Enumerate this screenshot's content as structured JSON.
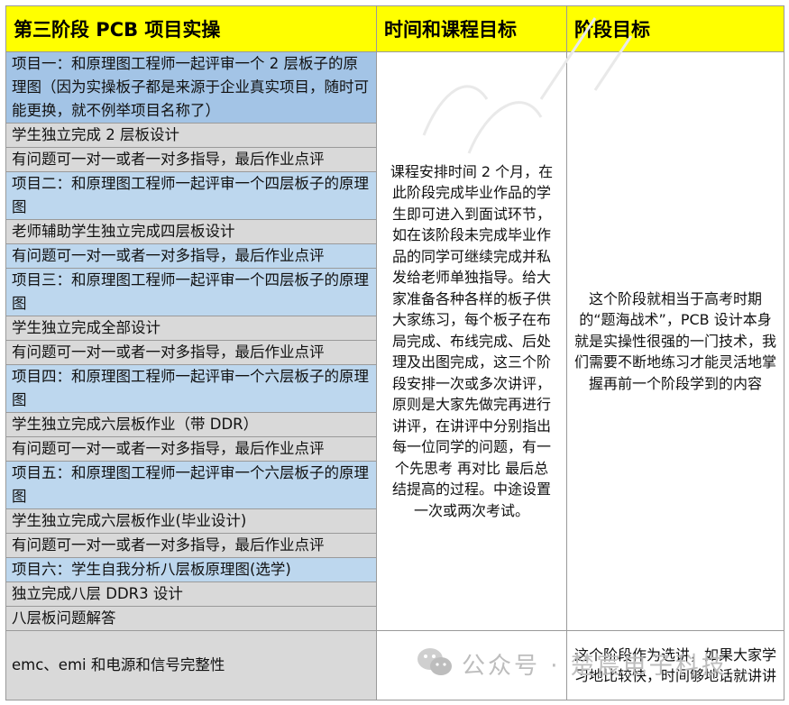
{
  "headers": {
    "col1": "第三阶段 PCB  项目实操",
    "col2": "时间和课程目标",
    "col3": "阶段目标"
  },
  "rows": [
    {
      "text": "项目一：和原理图工程师一起评审一个 2 层板子的原理图（因为实操板子都是来源于企业真实项目，随时可能更换，就不例举项目名称了）",
      "style": "first-blue"
    },
    {
      "text": "学生独立完成 2 层板设计",
      "style": "gray"
    },
    {
      "text": "有问题可一对一或者一对多指导，最后作业点评",
      "style": "gray"
    },
    {
      "text": "项目二：和原理图工程师一起评审一个四层板子的原理图",
      "style": "blue"
    },
    {
      "text": "老师辅助学生独立完成四层板设计",
      "style": "gray"
    },
    {
      "text": "有问题可一对一或者一对多指导，最后作业点评",
      "style": "blue"
    },
    {
      "text": "项目三：和原理图工程师一起评审一个四层板子的原理图",
      "style": "blue"
    },
    {
      "text": "学生独立完成全部设计",
      "style": "gray"
    },
    {
      "text": "有问题可一对一或者一对多指导，最后作业点评",
      "style": "gray"
    },
    {
      "text": "项目四：和原理图工程师一起评审一个六层板子的原理图",
      "style": "blue"
    },
    {
      "text": "学生独立完成六层板作业（带 DDR）",
      "style": "gray"
    },
    {
      "text": "有问题可一对一或者一对多指导，最后作业点评",
      "style": "gray"
    },
    {
      "text": "项目五：和原理图工程师一起评审一个六层板子的原理图",
      "style": "blue"
    },
    {
      "text": "学生独立完成六层板作业(毕业设计)",
      "style": "gray"
    },
    {
      "text": "有问题可一对一或者一对多指导，最后作业点评",
      "style": "gray"
    },
    {
      "text": "项目六：学生自我分析八层板原理图(选学)",
      "style": "blue"
    },
    {
      "text": "独立完成八层 DDR3 设计",
      "style": "gray"
    },
    {
      "text": "八层板问题解答",
      "style": "gray"
    }
  ],
  "middle_text": "课程安排时间 2 个月，在此阶段完成毕业作品的学生即可进入到面试环节，如在该阶段未完成毕业作品的同学可继续完成并私发给老师单独指导。给大家准备各种各样的板子供大家练习，每个板子在布局完成、布线完成、后处理及出图完成，这三个阶段安排一次或多次讲评，原则是大家先做完再进行讲评，在讲评中分别指出每一位同学的问题，有一个先思考 再对比 最后总结提高的过程。中途设置一次或两次考试。",
  "right_text": "这个阶段就相当于高考时期的“题海战术”，PCB 设计本身就是实操性很强的一门技术，我们需要不断地练习才能灵活地掌握再前一个阶段学到的内容",
  "last_row": {
    "left": "emc、emi 和电源和信号完整性",
    "right": "这个阶段作为选讲，如果大家学习地比较快，时间够地话就讲讲"
  },
  "watermark": "公众号 · 楚宸电子科技",
  "colors": {
    "header": "#ffff00",
    "blue_row": "#bdd7ee",
    "gray_row": "#d9d9d9",
    "border": "#9a9a9a"
  }
}
